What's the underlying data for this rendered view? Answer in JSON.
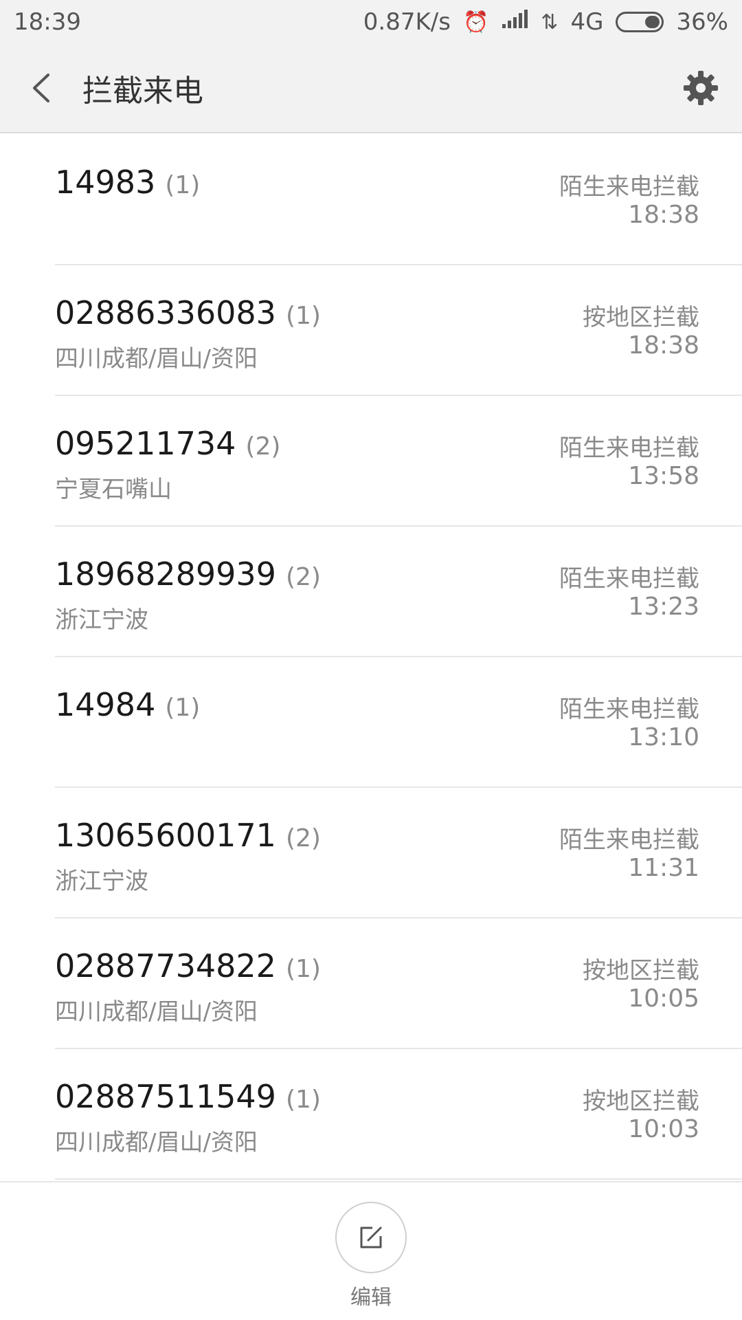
{
  "status_bar": {
    "time": "18:39",
    "net_speed": "0.87K/s",
    "network": "4G",
    "battery_percent_text": "36%",
    "battery_level": 0.36
  },
  "header": {
    "title": "拦截来电"
  },
  "calls": [
    {
      "number": "14983",
      "count": "(1)",
      "location": "",
      "type": "陌生来电拦截",
      "time": "18:38"
    },
    {
      "number": "02886336083",
      "count": "(1)",
      "location": "四川成都/眉山/资阳",
      "type": "按地区拦截",
      "time": "18:38"
    },
    {
      "number": "095211734",
      "count": "(2)",
      "location": "宁夏石嘴山",
      "type": "陌生来电拦截",
      "time": "13:58"
    },
    {
      "number": "18968289939",
      "count": "(2)",
      "location": "浙江宁波",
      "type": "陌生来电拦截",
      "time": "13:23"
    },
    {
      "number": "14984",
      "count": "(1)",
      "location": "",
      "type": "陌生来电拦截",
      "time": "13:10"
    },
    {
      "number": "13065600171",
      "count": "(2)",
      "location": "浙江宁波",
      "type": "陌生来电拦截",
      "time": "11:31"
    },
    {
      "number": "02887734822",
      "count": "(1)",
      "location": "四川成都/眉山/资阳",
      "type": "按地区拦截",
      "time": "10:05"
    },
    {
      "number": "02887511549",
      "count": "(1)",
      "location": "四川成都/眉山/资阳",
      "type": "按地区拦截",
      "time": "10:03"
    }
  ],
  "bottom": {
    "edit_label": "编辑"
  }
}
